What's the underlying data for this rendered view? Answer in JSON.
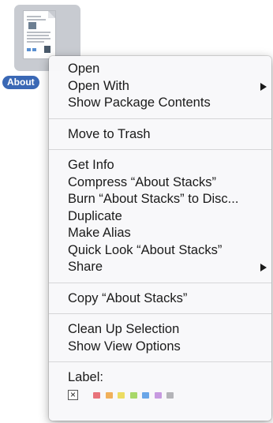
{
  "desktop": {
    "file_label": "About"
  },
  "menu": {
    "group1": [
      "Open",
      "Open With",
      "Show Package Contents"
    ],
    "group2": [
      "Move to Trash"
    ],
    "group3": [
      "Get Info",
      "Compress “About Stacks”",
      "Burn “About Stacks” to Disc...",
      "Duplicate",
      "Make Alias",
      "Quick Look “About Stacks”",
      "Share"
    ],
    "group4": [
      "Copy “About Stacks”"
    ],
    "group5": [
      "Clean Up Selection",
      "Show View Options"
    ],
    "label_heading": "Label:",
    "label_none_mark": "×",
    "label_colors": [
      {
        "name": "red",
        "hex": "#e8737b"
      },
      {
        "name": "orange",
        "hex": "#f0b05a"
      },
      {
        "name": "yellow",
        "hex": "#ecdc62"
      },
      {
        "name": "green",
        "hex": "#a8d86a"
      },
      {
        "name": "blue",
        "hex": "#6aa6e8"
      },
      {
        "name": "purple",
        "hex": "#c79ae0"
      },
      {
        "name": "gray",
        "hex": "#b4b4b8"
      }
    ],
    "submenu_items": [
      "Open With",
      "Share"
    ]
  }
}
